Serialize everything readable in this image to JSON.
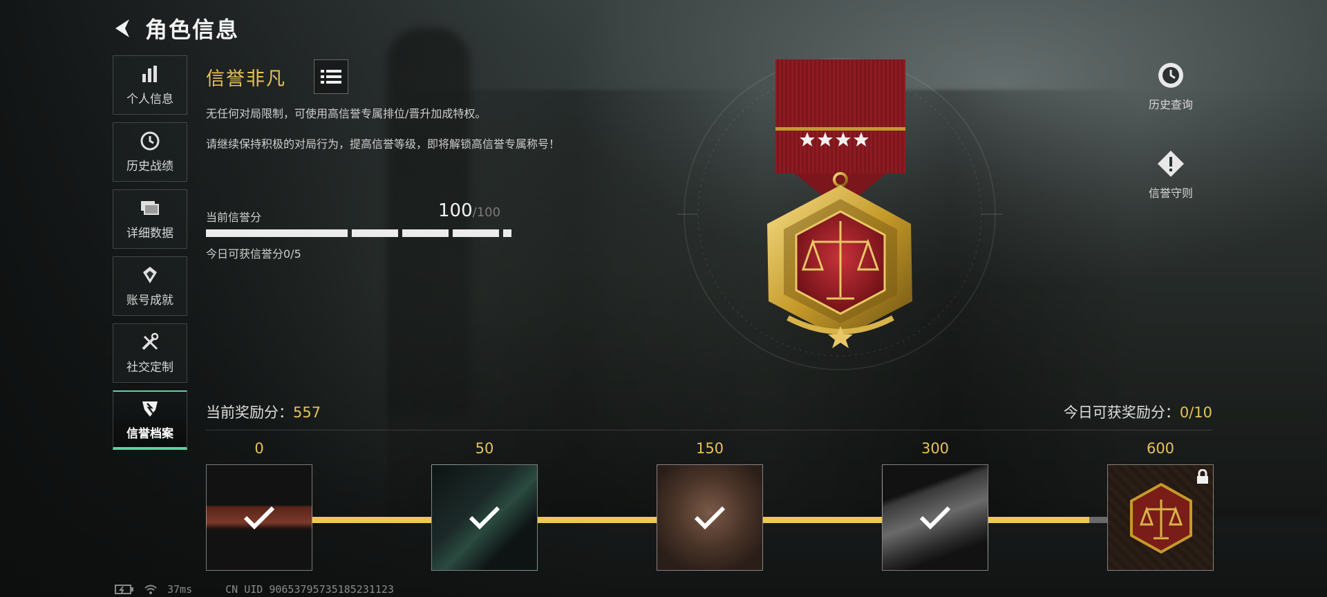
{
  "header": {
    "title": "角色信息"
  },
  "sidebar": {
    "items": [
      {
        "label": "个人信息",
        "icon": "bar-chart-icon",
        "active": false
      },
      {
        "label": "历史战绩",
        "icon": "history-clock-icon",
        "active": false
      },
      {
        "label": "详细数据",
        "icon": "cards-icon",
        "active": false
      },
      {
        "label": "账号成就",
        "icon": "achievement-badge-icon",
        "active": false
      },
      {
        "label": "社交定制",
        "icon": "tools-icon",
        "active": true
      },
      {
        "label": "信誉档案",
        "icon": "credit-shield-icon",
        "active": true
      }
    ]
  },
  "credit": {
    "tier_name": "信誉非凡",
    "desc1": "无任何对局限制，可使用高信誉专属排位/晋升加成特权。",
    "desc2": "请继续保持积极的对局行为，提高信誉等级，即将解锁高信誉专属称号！",
    "score_label": "当前信誉分",
    "score": "100",
    "score_max": "/100",
    "today_label": "今日可获信誉分0/5"
  },
  "right_buttons": {
    "history": "历史查询",
    "rules": "信誉守则"
  },
  "reward": {
    "current_label": "当前奖励分：",
    "current_value": "557",
    "today_label": "今日可获奖励分：",
    "today_value": "0/10",
    "milestones": [
      {
        "value": "0",
        "claimed": true,
        "locked": false
      },
      {
        "value": "50",
        "claimed": true,
        "locked": false
      },
      {
        "value": "150",
        "claimed": true,
        "locked": false
      },
      {
        "value": "300",
        "claimed": true,
        "locked": false
      },
      {
        "value": "600",
        "claimed": false,
        "locked": true
      }
    ]
  },
  "status_bar": {
    "ping": "37ms",
    "uid": "CN UID 90653795735185231123"
  },
  "colors": {
    "accent_gold": "#e7c35a",
    "active_green": "#5fd2a0",
    "track_yellow": "#f0c755"
  }
}
